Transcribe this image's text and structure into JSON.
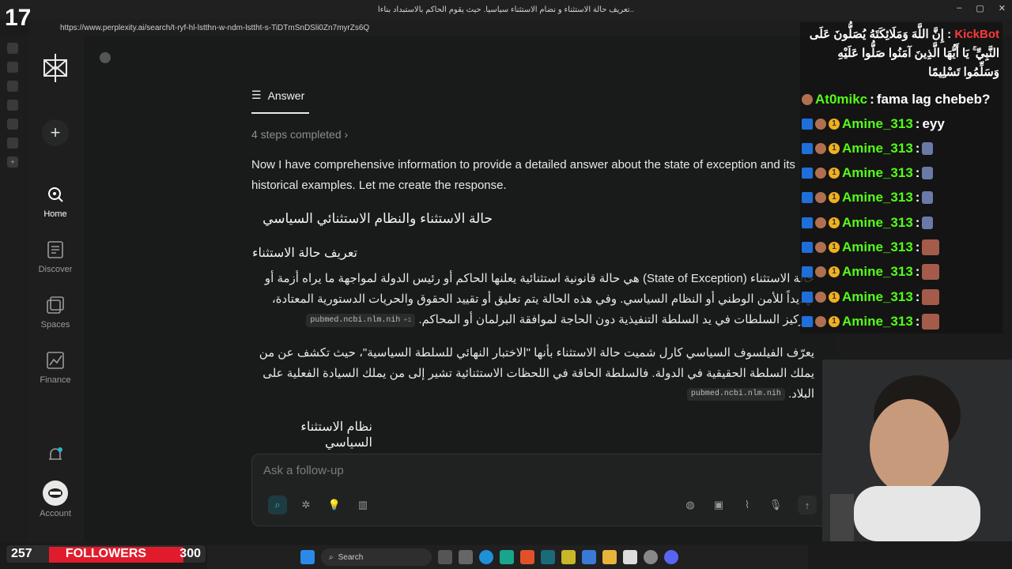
{
  "window": {
    "title": "تعريف حالة الاستثناء و نضام الاستثناء سياسيا. حيث يقوم الحاكم بالاستبداد بناءا..",
    "url": "https://www.perplexity.ai/search/t-ryf-hl-lstthn-w-ndm-lsttht-s-TiDTmSnDSli0Zn7myrZs6Q"
  },
  "overlay": {
    "viewer_count": "17",
    "followers_current": "257",
    "followers_label": "FOLLOWERS",
    "followers_goal": "300"
  },
  "sidebar": {
    "items": [
      {
        "label": "Home",
        "icon": "search-icon"
      },
      {
        "label": "Discover",
        "icon": "discover-icon"
      },
      {
        "label": "Spaces",
        "icon": "spaces-icon"
      },
      {
        "label": "Finance",
        "icon": "finance-icon"
      },
      {
        "label": "Account",
        "icon": "avatar-icon"
      }
    ]
  },
  "answer": {
    "tab_label": "Answer",
    "steps": "4 steps completed",
    "intro": "Now I have comprehensive information to provide a detailed answer about the state of exception and its historical examples. Let me create the response.",
    "h1": "حالة الاستثناء والنظام الاستثنائي السياسي",
    "h2": "تعريف حالة الاستثناء",
    "p1": "حالة الاستثناء (State of Exception) هي حالة قانونية استثنائية يعلنها الحاكم أو رئيس الدولة لمواجهة ما يراه أزمة أو تهديداً للأمن الوطني أو النظام السياسي. وفي هذه الحالة يتم تعليق أو تقييد الحقوق والحريات الدستورية المعتادة، وتركيز السلطات في يد السلطة التنفيذية دون الحاجة لموافقة البرلمان أو المحاكم.",
    "p1_cite": "pubmed.ncbi.nlm.nih",
    "p1_cite_more": "+1",
    "p2": "يعرّف الفيلسوف السياسي كارل شميت حالة الاستثناء بأنها \"الاختبار النهائي للسلطة السياسية\"، حيث تكشف عن من يملك السلطة الحقيقية في الدولة. فالسلطة الحاقة في اللحظات الاستثنائية تشير إلى من يملك السيادة الفعلية على البلاد.",
    "p2_cite": "pubmed.ncbi.nlm.nih",
    "h3": "نظام الاستثناء السياسي"
  },
  "composer": {
    "placeholder": "Ask a follow-up"
  },
  "chat": {
    "pinned": "إِنَّ اللَّهَ وَمَلَائِكَتَهُ يُصَلُّونَ عَلَى النَّبِيِّ ۚ يَا أَيُّهَا الَّذِينَ آمَنُوا صَلُّوا عَلَيْهِ وَسَلِّمُوا تَسْلِيمًا",
    "pinned_user": "KickBot",
    "messages": [
      {
        "user": "At0mikc",
        "text": "fama lag chebeb?",
        "color": "#53fc18"
      },
      {
        "user": "Amine_313",
        "text": "eyy",
        "color": "#53fc18"
      },
      {
        "user": "Amine_313",
        "text": "",
        "color": "#53fc18"
      },
      {
        "user": "Amine_313",
        "text": "",
        "color": "#53fc18"
      },
      {
        "user": "Amine_313",
        "text": "",
        "color": "#53fc18"
      },
      {
        "user": "Amine_313",
        "text": "",
        "color": "#53fc18"
      },
      {
        "user": "Amine_313",
        "text": "",
        "color": "#53fc18"
      },
      {
        "user": "Amine_313",
        "text": "",
        "color": "#53fc18"
      },
      {
        "user": "Amine_313",
        "text": "",
        "color": "#53fc18"
      },
      {
        "user": "Amine_313",
        "text": "",
        "color": "#53fc18"
      }
    ]
  },
  "taskbar": {
    "search_label": "Search"
  },
  "colors": {
    "kick_green": "#53fc18",
    "followers_red": "#e01c2c",
    "bg": "#191a1a"
  }
}
